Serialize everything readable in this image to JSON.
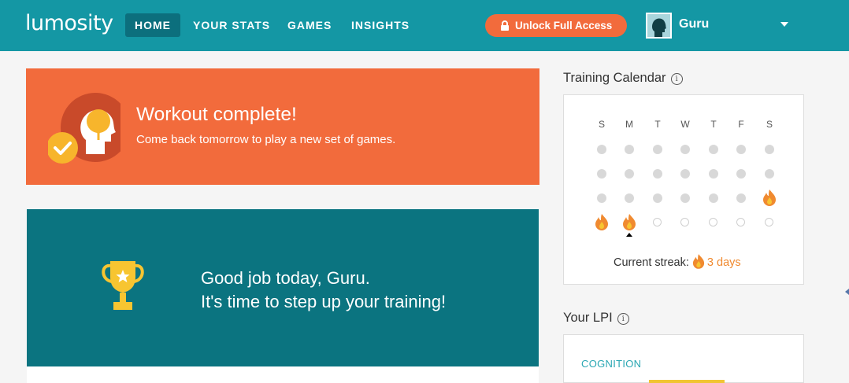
{
  "brand": {
    "logo": "lumosity",
    "accent": "#1497a4",
    "orange": "#f26b3c",
    "teal_dark": "#0b7480"
  },
  "nav": {
    "items": [
      {
        "label": "HOME",
        "active": true
      },
      {
        "label": "YOUR STATS",
        "active": false
      },
      {
        "label": "GAMES",
        "active": false
      },
      {
        "label": "INSIGHTS",
        "active": false
      }
    ],
    "unlock_label": "Unlock Full Access",
    "user_name": "Guru"
  },
  "workout": {
    "title": "Workout complete!",
    "subtitle": "Come back tomorrow to play a new set of games."
  },
  "goodjob": {
    "line1": "Good job today, Guru.",
    "line2": "It's time to step up your training!"
  },
  "calendar": {
    "heading": "Training Calendar",
    "info_icon": "i",
    "days": [
      "S",
      "M",
      "T",
      "W",
      "T",
      "F",
      "S"
    ],
    "weeks": [
      [
        "past",
        "past",
        "past",
        "past",
        "past",
        "past",
        "past"
      ],
      [
        "past",
        "past",
        "past",
        "past",
        "past",
        "past",
        "past"
      ],
      [
        "past",
        "past",
        "past",
        "past",
        "past",
        "past",
        "trained"
      ],
      [
        "trained",
        "trained-today",
        "future",
        "future",
        "future",
        "future",
        "future"
      ]
    ],
    "streak_label": "Current streak:",
    "streak_value": "3 days"
  },
  "lpi": {
    "heading": "Your LPI",
    "info_icon": "i",
    "category": "COGNITION"
  }
}
